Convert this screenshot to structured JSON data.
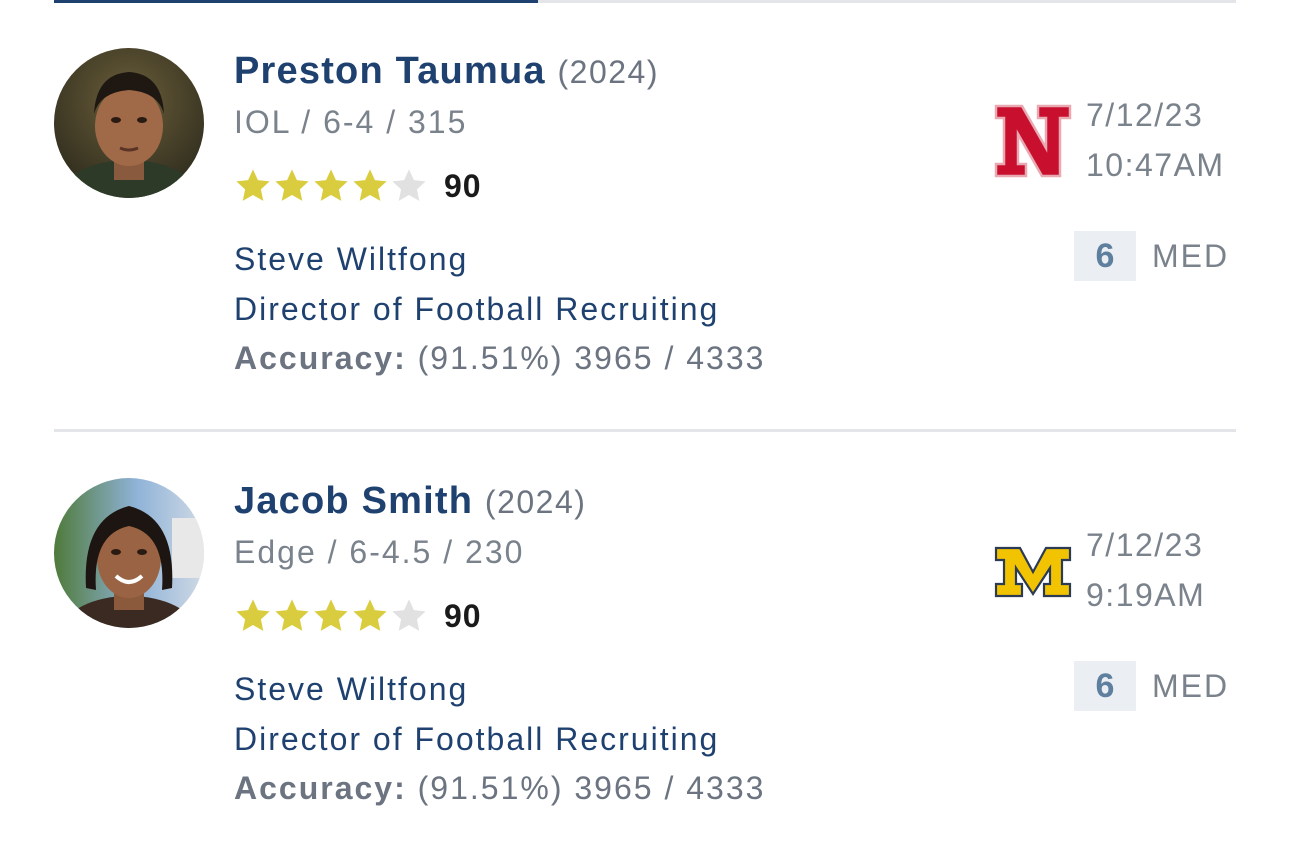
{
  "predictions": [
    {
      "player": {
        "name": "Preston Taumua",
        "class_year": "(2024)",
        "position_height_weight": "IOL / 6-4 / 315",
        "stars": 4,
        "rating": "90",
        "photo": "player-headshot"
      },
      "analyst": {
        "name": "Steve Wiltfong",
        "title": "Director of Football Recruiting",
        "accuracy_label": "Accuracy:",
        "accuracy_value": "(91.51%) 3965 / 4333"
      },
      "school": {
        "logo": "nebraska-n-logo",
        "color": "#c8102e"
      },
      "date": "7/12/23",
      "time": "10:47AM",
      "confidence": {
        "value": "6",
        "label": "MED"
      }
    },
    {
      "player": {
        "name": "Jacob Smith",
        "class_year": "(2024)",
        "position_height_weight": "Edge / 6-4.5 / 230",
        "stars": 4,
        "rating": "90",
        "photo": "player-headshot"
      },
      "analyst": {
        "name": "Steve Wiltfong",
        "title": "Director of Football Recruiting",
        "accuracy_label": "Accuracy:",
        "accuracy_value": "(91.51%) 3965 / 4333"
      },
      "school": {
        "logo": "michigan-block-m-logo",
        "color": "#f2c300"
      },
      "date": "7/12/23",
      "time": "9:19AM",
      "confidence": {
        "value": "6",
        "label": "MED"
      }
    }
  ],
  "colors": {
    "name": "#1f4170",
    "star_filled": "#d9cd3f",
    "star_empty": "#e1e1e1",
    "tab_active": "#1f4170",
    "divider": "#e3e5e8"
  }
}
